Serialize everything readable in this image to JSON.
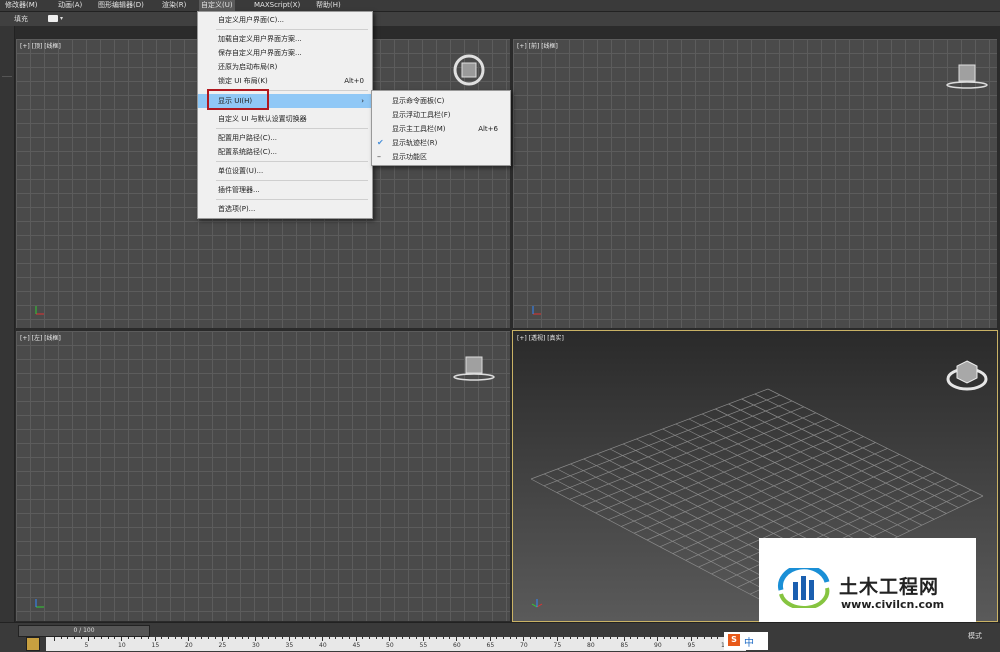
{
  "menubar": {
    "items": [
      "修改器(M)",
      "动画(A)",
      "图形编辑器(D)",
      "渲染(R)",
      "自定义(U)",
      "MAXScript(X)",
      "帮助(H)"
    ]
  },
  "subbar": {
    "fill_label": "填充"
  },
  "custom_menu": {
    "items": [
      {
        "label": "自定义用户界面(C)...",
        "shortcut": ""
      },
      {
        "label": "加载自定义用户界面方案...",
        "shortcut": ""
      },
      {
        "label": "保存自定义用户界面方案...",
        "shortcut": ""
      },
      {
        "label": "还原为启动布局(R)",
        "shortcut": ""
      },
      {
        "label": "锁定 UI 布局(K)",
        "shortcut": "Alt+0"
      },
      {
        "label": "显示 UI(H)",
        "shortcut": ""
      },
      {
        "label": "自定义 UI 与默认设置切换器",
        "shortcut": ""
      },
      {
        "label": "配置用户路径(C)...",
        "shortcut": ""
      },
      {
        "label": "配置系统路径(C)...",
        "shortcut": ""
      },
      {
        "label": "单位设置(U)...",
        "shortcut": ""
      },
      {
        "label": "插件管理器...",
        "shortcut": ""
      },
      {
        "label": "首选项(P)...",
        "shortcut": ""
      }
    ]
  },
  "show_ui_submenu": {
    "items": [
      {
        "label": "显示命令面板(C)",
        "shortcut": "",
        "checked": false
      },
      {
        "label": "显示浮动工具栏(F)",
        "shortcut": "",
        "checked": false
      },
      {
        "label": "显示主工具栏(M)",
        "shortcut": "Alt+6",
        "checked": false
      },
      {
        "label": "显示轨迹栏(R)",
        "shortcut": "",
        "checked": true
      },
      {
        "label": "显示功能区",
        "shortcut": "",
        "checked": false
      }
    ]
  },
  "viewports": {
    "top": "[+] [顶] [线框]",
    "front": "[+] [前] [线框]",
    "left": "[+] [左] [线框]",
    "perspective": "[+] [透视] [真实]"
  },
  "timeline": {
    "slider": "0 / 100",
    "ticks": [
      "5",
      "10",
      "15",
      "20",
      "25",
      "30",
      "35",
      "40",
      "45",
      "50",
      "55",
      "60",
      "65",
      "70",
      "75",
      "80",
      "85",
      "90",
      "95",
      "100"
    ],
    "mode_label": "模式"
  },
  "ime": {
    "mark": "S",
    "lang": "中"
  },
  "watermark": {
    "title": "土木工程网",
    "url": "www.civilcn.com"
  },
  "colors": {
    "menu_highlight": "#90c8f6",
    "red_outline": "#b0181f",
    "persp_border": "#c9b265"
  }
}
